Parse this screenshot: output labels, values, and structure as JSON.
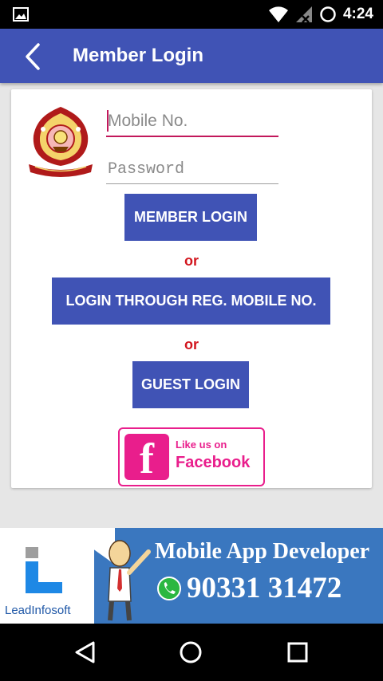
{
  "status_bar": {
    "time": "4:24"
  },
  "app_bar": {
    "title": "Member Login"
  },
  "login_form": {
    "mobile_placeholder": "Mobile No.",
    "password_placeholder": "Password",
    "member_login_label": "MEMBER LOGIN",
    "or_text_1": "or",
    "reg_mobile_login_label": "LOGIN THROUGH REG. MOBILE NO.",
    "or_text_2": "or",
    "guest_login_label": "GUEST LOGIN"
  },
  "facebook_badge": {
    "line1": "Like us on",
    "line2": "Facebook"
  },
  "ad_banner": {
    "logo_name": "LeadInfosoft",
    "title": "Mobile App Developer",
    "phone": "90331 31472"
  },
  "icons": {
    "status": [
      "image-icon",
      "wifi-icon",
      "signal-icon",
      "alarm-icon"
    ],
    "nav": [
      "back-triangle-icon",
      "home-circle-icon",
      "recents-square-icon"
    ]
  },
  "colors": {
    "primary": "#4053b5",
    "accent": "#c2185b",
    "or_text": "#d2161e",
    "facebook_badge": "#e91e8c",
    "ad_background": "#3a77bf"
  }
}
